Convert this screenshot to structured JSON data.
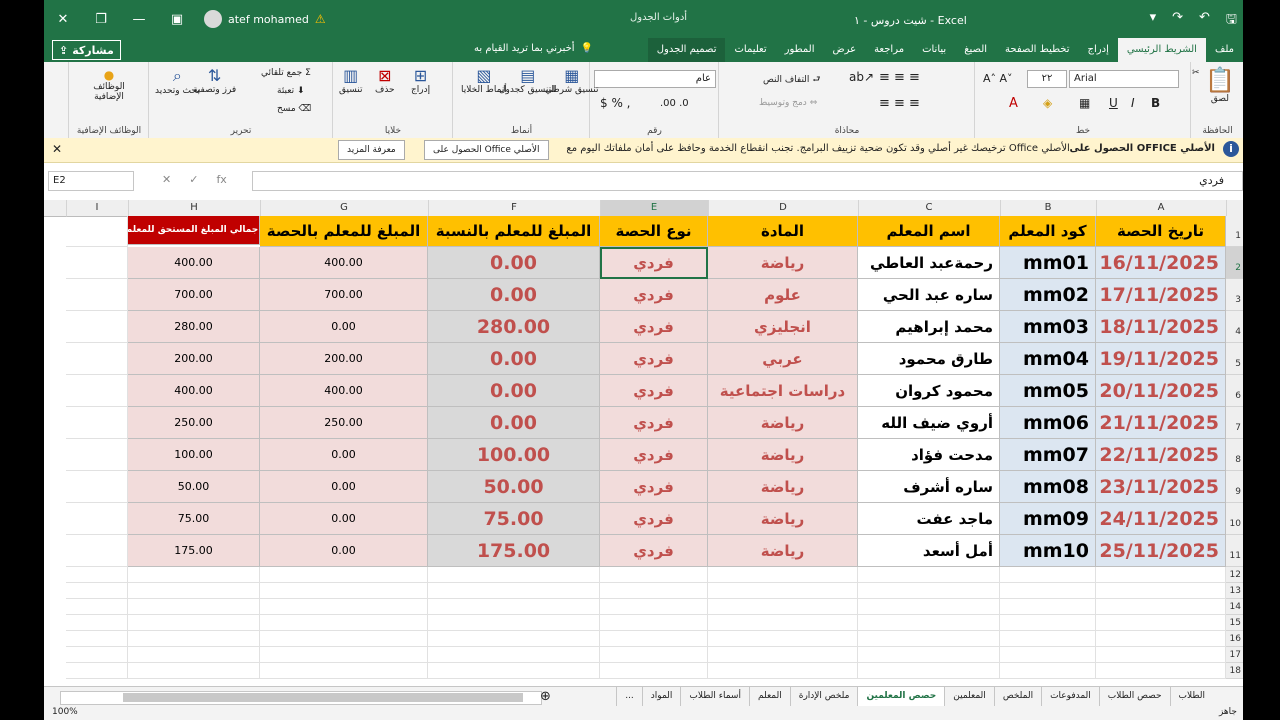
{
  "window": {
    "user_name": "atef mohamed",
    "context_tools": "أدوات الجدول",
    "doc_title": "شيت دروس - ١   -   Excel"
  },
  "tabs": {
    "share": "مشاركة",
    "tell_me": "أخبرني بما تريد القيام به",
    "items": [
      "ملف",
      "الشريط الرئيسي",
      "إدراج",
      "تخطيط الصفحة",
      "الصيغ",
      "بيانات",
      "مراجعة",
      "عرض",
      "المطور",
      "تعليمات",
      "تصميم الجدول"
    ],
    "active": "الشريط الرئيسي"
  },
  "ribbon": {
    "clipboard": {
      "name": "الحافظة",
      "paste": "لصق"
    },
    "font": {
      "name": "خط",
      "family": "Arial",
      "size": "٢٢"
    },
    "alignment": {
      "name": "محاذاة",
      "wrap": "التفاف النص",
      "merge": "دمج وتوسيط"
    },
    "number": {
      "name": "رقم",
      "format": "عام"
    },
    "styles": {
      "name": "أنماط",
      "conditional": "تنسيق شرطي",
      "as_table": "التنسيق كجدول",
      "cell_styles": "أنماط الخلايا"
    },
    "cells": {
      "name": "خلايا",
      "insert": "إدراج",
      "delete": "حذف",
      "format": "تنسيق"
    },
    "editing": {
      "name": "تحرير",
      "autosum": "جمع تلقائي",
      "fill": "تعبئة",
      "clear": "مسح",
      "sort": "فرز وتصفية",
      "find": "بحث وتحديد"
    },
    "addins": {
      "name": "الوظائف الإضافية",
      "label": "الوظائف الإضافية"
    }
  },
  "message_bar": {
    "title": "الحصول على OFFICE الأصلي",
    "text": "ترخيصك غير أصلي وقد تكون ضحية تزييف البرامج. تجنب انقطاع الخدمة وحافظ على أمان ملفاتك اليوم مع Office الأصلي.",
    "btn_get": "الحصول على Office الأصلي",
    "btn_more": "معرفة المزيد"
  },
  "formula_bar": {
    "name_box": "E2",
    "value": "فردي"
  },
  "columns": [
    "A",
    "B",
    "C",
    "D",
    "E",
    "F",
    "G",
    "H",
    "I"
  ],
  "headers": {
    "date": "تاريخ الحصة",
    "code": "كود المعلم",
    "name": "اسم المعلم",
    "subject": "المادة",
    "type": "نوع الحصة",
    "pct": "المبلغ للمعلم بالنسبة",
    "per": "المبلغ للمعلم بالحصة",
    "total": "اجمالي المبلغ المستحق للمعلم"
  },
  "rows": [
    {
      "n": "2",
      "date": "16/11/2025",
      "code": "mm01",
      "name": "رحمةعبد العاطي",
      "subject": "رياضة",
      "type": "فردي",
      "pct": "0.00",
      "per": "400.00",
      "total": "400.00"
    },
    {
      "n": "3",
      "date": "17/11/2025",
      "code": "mm02",
      "name": "ساره عبد الحي",
      "subject": "علوم",
      "type": "فردي",
      "pct": "0.00",
      "per": "700.00",
      "total": "700.00"
    },
    {
      "n": "4",
      "date": "18/11/2025",
      "code": "mm03",
      "name": "محمد إبراهيم",
      "subject": "انجليزي",
      "type": "فردي",
      "pct": "280.00",
      "per": "0.00",
      "total": "280.00"
    },
    {
      "n": "5",
      "date": "19/11/2025",
      "code": "mm04",
      "name": "طارق محمود",
      "subject": "عربي",
      "type": "فردي",
      "pct": "0.00",
      "per": "200.00",
      "total": "200.00"
    },
    {
      "n": "6",
      "date": "20/11/2025",
      "code": "mm05",
      "name": "محمود كروان",
      "subject": "دراسات اجتماعية",
      "type": "فردي",
      "pct": "0.00",
      "per": "400.00",
      "total": "400.00"
    },
    {
      "n": "7",
      "date": "21/11/2025",
      "code": "mm06",
      "name": "أروي ضيف الله",
      "subject": "رياضة",
      "type": "فردي",
      "pct": "0.00",
      "per": "250.00",
      "total": "250.00"
    },
    {
      "n": "8",
      "date": "22/11/2025",
      "code": "mm07",
      "name": "مدحت فؤاد",
      "subject": "رياضة",
      "type": "فردي",
      "pct": "100.00",
      "per": "0.00",
      "total": "100.00"
    },
    {
      "n": "9",
      "date": "23/11/2025",
      "code": "mm08",
      "name": "ساره أشرف",
      "subject": "رياضة",
      "type": "فردي",
      "pct": "50.00",
      "per": "0.00",
      "total": "50.00"
    },
    {
      "n": "10",
      "date": "24/11/2025",
      "code": "mm09",
      "name": "ماجد عفت",
      "subject": "رياضة",
      "type": "فردي",
      "pct": "75.00",
      "per": "0.00",
      "total": "75.00"
    },
    {
      "n": "11",
      "date": "25/11/2025",
      "code": "mm10",
      "name": "أمل أسعد",
      "subject": "رياضة",
      "type": "فردي",
      "pct": "175.00",
      "per": "0.00",
      "total": "175.00"
    }
  ],
  "extra_rows": [
    "12",
    "13",
    "14",
    "15",
    "16",
    "17",
    "18"
  ],
  "sheets": [
    "الطلاب",
    "حصص الطلاب",
    "المدفوعات",
    "الملخص",
    "المعلمين",
    "حصص المعلمين",
    "ملخص الإدارة",
    "المعلم",
    "أسماء الطلاب",
    "المواد",
    "..."
  ],
  "active_sheet": "حصص المعلمين",
  "status": {
    "zoom": "100%",
    "ready": "جاهز"
  }
}
